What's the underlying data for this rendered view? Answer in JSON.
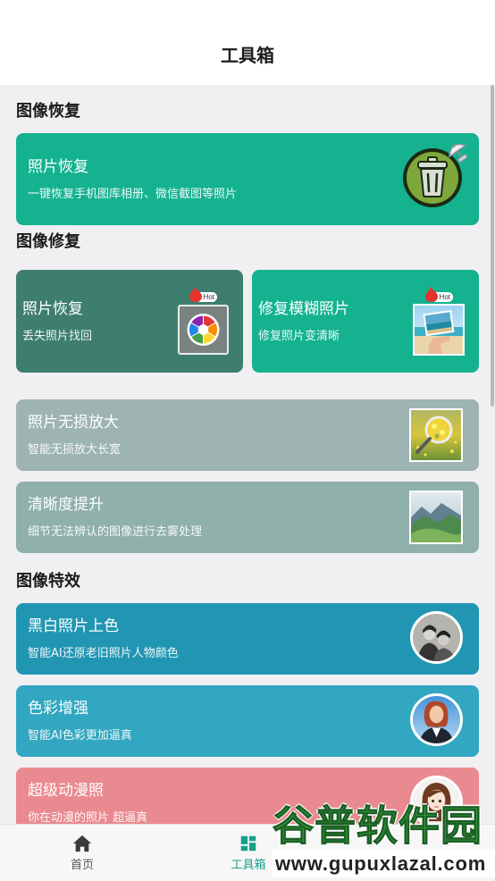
{
  "colors": {
    "page_bg": "#f0f0f3",
    "accent": "#17a189"
  },
  "header": {
    "title": "工具箱"
  },
  "sections": {
    "restore": {
      "title": "图像恢复",
      "card": {
        "title": "照片恢复",
        "subtitle": "一键恢复手机图库相册、微信截图等照片",
        "color": "#15b290",
        "icon": "trash-can-icon",
        "corner_icon": "satellite-dish-icon"
      }
    },
    "repair": {
      "title": "图像修复",
      "tiles": [
        {
          "title": "照片恢复",
          "subtitle": "丢失照片找回",
          "badge": "Hot",
          "color": "#3e7e6f",
          "icon": "camera-aperture-icon"
        },
        {
          "title": "修复模糊照片",
          "subtitle": "修复照片变清晰",
          "badge": "Hot",
          "color": "#15b290",
          "icon": "beach-photo-thumbnail"
        }
      ],
      "cards": [
        {
          "title": "照片无损放大",
          "subtitle": "智能无损放大长宽",
          "color": "#9db4b3",
          "icon": "magnifier-flower-field-thumbnail"
        },
        {
          "title": "清晰度提升",
          "subtitle": "细节无法辨认的图像进行去雾处理",
          "color": "#8fb0ab",
          "icon": "mountain-landscape-thumbnail"
        }
      ]
    },
    "effects": {
      "title": "图像特效",
      "cards": [
        {
          "title": "黑白照片上色",
          "subtitle": "智能AI还原老旧照片人物颜色",
          "color": "#2196b3",
          "icon": "black-white-portrait-avatar"
        },
        {
          "title": "色彩增强",
          "subtitle": "智能AI色彩更加逼真",
          "color": "#32a7c1",
          "icon": "color-portrait-avatar"
        },
        {
          "title": "超级动漫照",
          "subtitle": "你在动漫的照片 超逼真",
          "color": "#e98a90",
          "icon": "anime-portrait-avatar"
        }
      ]
    }
  },
  "bottom_nav": {
    "items": [
      {
        "label": "首页",
        "icon": "home-icon",
        "active": false
      },
      {
        "label": "工具箱",
        "icon": "dashboard-grid-icon",
        "active": true
      }
    ]
  },
  "watermark": {
    "name": "谷普软件园",
    "url": "www.gupuxlazal.com"
  }
}
